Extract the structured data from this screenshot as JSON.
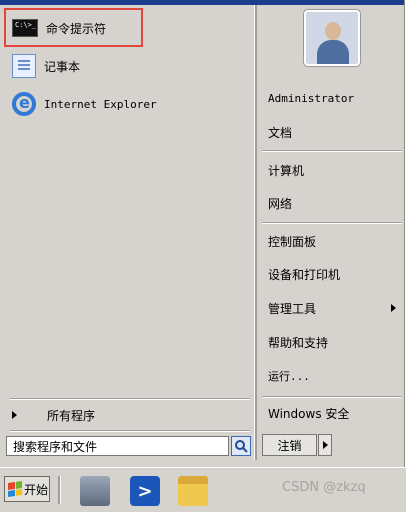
{
  "pinned_programs": [
    {
      "label": "命令提示符",
      "icon": "cmd-icon",
      "icon_text": "C:\\>_"
    },
    {
      "label": "记事本",
      "icon": "notepad-icon"
    },
    {
      "label": "Internet Explorer",
      "icon": "ie-icon"
    }
  ],
  "all_programs_label": "所有程序",
  "search": {
    "placeholder": "搜索程序和文件"
  },
  "right_pane": {
    "user": "Administrator",
    "items": [
      "文档",
      "计算机",
      "网络",
      "控制面板",
      "设备和打印机",
      "管理工具",
      "帮助和支持",
      "运行...",
      "Windows 安全"
    ]
  },
  "shutdown_label": "注销",
  "taskbar": {
    "start_label": "开始"
  },
  "watermark": "CSDN @zkzq",
  "colors": {
    "highlight_border": "#e0483c",
    "menu_bg": "#d6d3ce",
    "top_bar": "#1e3c8c"
  }
}
